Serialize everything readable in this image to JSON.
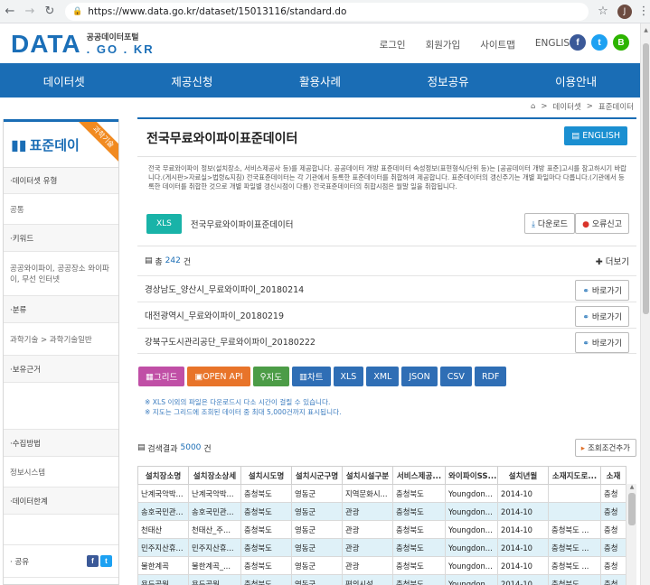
{
  "browser": {
    "url": "https://www.data.go.kr/dataset/15013116/standard.do",
    "profile_initial": "J"
  },
  "header": {
    "logo_main": "DATA",
    "logo_kr": "공공데이터포털",
    "logo_sub": ". GO . KR",
    "links": [
      "로그인",
      "회원가입",
      "사이트맵",
      "ENGLISH"
    ],
    "social": [
      "f",
      "t",
      "B"
    ]
  },
  "nav": [
    "데이터셋",
    "제공신청",
    "활용사례",
    "정보공유",
    "이용안내"
  ],
  "breadcrumb": [
    "데이터셋",
    "표준데이터"
  ],
  "sidebar": {
    "title": "표준데이",
    "ribbon": "과학기술",
    "rows": [
      {
        "text": "·데이터셋 유형",
        "type": "sec",
        "h": 29
      },
      {
        "text": "공통",
        "type": "val",
        "h": 34
      },
      {
        "text": "·키워드",
        "type": "sec",
        "h": 30
      },
      {
        "text": "공공와이파이, 공공장소 와이파이, 무선 인터넷",
        "type": "val",
        "h": 49
      },
      {
        "text": "·분류",
        "type": "sec",
        "h": 30
      },
      {
        "text": "과학기술 > 과학기술일반",
        "type": "val",
        "h": 36
      },
      {
        "text": "·보유근거",
        "type": "sec",
        "h": 30
      },
      {
        "text": "",
        "type": "val",
        "h": 52
      },
      {
        "text": "·수집방법",
        "type": "sec",
        "h": 30
      },
      {
        "text": "정보시스템",
        "type": "val",
        "h": 34
      },
      {
        "text": "·데이터한계",
        "type": "sec",
        "h": 30
      },
      {
        "text": "",
        "type": "val",
        "h": 34
      }
    ],
    "share_label": "· 공유"
  },
  "content": {
    "title": "전국무료와이파이표준데이터",
    "english_btn": "ENGLISH",
    "description": "전국 무료와이파이 정보(설치장소, 서비스제공사 등)를 제공합니다. 공공데이터 개방 표준데이터 속성정보(표현형식/단위 등)는 [공공데이터 개방 표준]고시를 참고하시기 바랍니다.(게시판>자료실>법령&지침) 전국표준데이터는 각 기관에서 등록한 표준데이터를 취합하여 제공합니다. 표준데이터의 갱신주기는 개별 파일마다 다릅니다.(기관에서 등록한 데이터를 취합한 것으로 개별 파일별 갱신시점이 다름) 전국표준데이터의 취합시점은 월말 일을 취합됩니다.",
    "file_badge": "XLS",
    "file_name": "전국무료와이파이표준데이터",
    "download_btn": "다운로드",
    "error_btn": "오류신고",
    "total_prefix": "총",
    "total_count": "242",
    "total_suffix": "건",
    "more_btn": "더보기",
    "list": [
      "경상남도_양산시_무료와이파이_20180214",
      "대전광역시_무료와이파이_20180219",
      "강북구도시관리공단_무료와이파이_20180222"
    ],
    "go_btn": "바로가기",
    "formats": [
      {
        "label": "그리드",
        "color": "#c04fa6",
        "icon": "▦"
      },
      {
        "label": "OPEN API",
        "color": "#e8742a",
        "icon": "▣"
      },
      {
        "label": "지도",
        "color": "#4c9c47",
        "icon": "⚲"
      },
      {
        "label": "차트",
        "color": "#2f6eb5",
        "icon": "▥"
      },
      {
        "label": "XLS",
        "color": "#2f6eb5",
        "icon": ""
      },
      {
        "label": "XML",
        "color": "#2f6eb5",
        "icon": ""
      },
      {
        "label": "JSON",
        "color": "#2f6eb5",
        "icon": ""
      },
      {
        "label": "CSV",
        "color": "#2f6eb5",
        "icon": ""
      },
      {
        "label": "RDF",
        "color": "#2f6eb5",
        "icon": ""
      }
    ],
    "notes": [
      "※ XLS 이외의 파일은 다운로드시 다소 시간이 걸릴 수 있습니다.",
      "※ 지도는 그리드에 조회된 데이터 중 최대 5,000건까지 표시됩니다."
    ],
    "result_prefix": "검색결과",
    "result_count": "5000",
    "result_suffix": "건",
    "cond_btn": "조회조건추가"
  },
  "table": {
    "headers": [
      "설치장소명",
      "설치장소상세",
      "설치시도명",
      "설치시군구명",
      "설치시설구분",
      "서비스제공...",
      "와이파이SS...",
      "설치년월",
      "소재지도로...",
      "소재"
    ],
    "rows": [
      [
        "난계국악박...",
        "난계국악박...",
        "충청북도",
        "영동군",
        "지역문화시...",
        "충청북도",
        "Youngdon...",
        "2014-10",
        "",
        "충청"
      ],
      [
        "송호국민관...",
        "송호국민관...",
        "충청북도",
        "영동군",
        "관광",
        "충청북도",
        "Youngdon...",
        "2014-10",
        "",
        "충청"
      ],
      [
        "천태산",
        "천태산_주...",
        "충청북도",
        "영동군",
        "관광",
        "충청북도",
        "Youngdon...",
        "2014-10",
        "충청북도 ...",
        "충청"
      ],
      [
        "민주지산휴...",
        "민주지산휴...",
        "충청북도",
        "영동군",
        "관광",
        "충청북도",
        "Youngdon...",
        "2014-10",
        "충청북도 ...",
        "충청"
      ],
      [
        "물한계곡",
        "물한계곡_...",
        "충청북도",
        "영동군",
        "관광",
        "충청북도",
        "Youngdon...",
        "2014-10",
        "충청북도 ...",
        "충청"
      ],
      [
        "용두공원",
        "용두공원_...",
        "충청북도",
        "영동군",
        "편의시설",
        "충청북도",
        "Youngdon...",
        "2014-10",
        "충청북도 ...",
        "충청"
      ]
    ]
  }
}
